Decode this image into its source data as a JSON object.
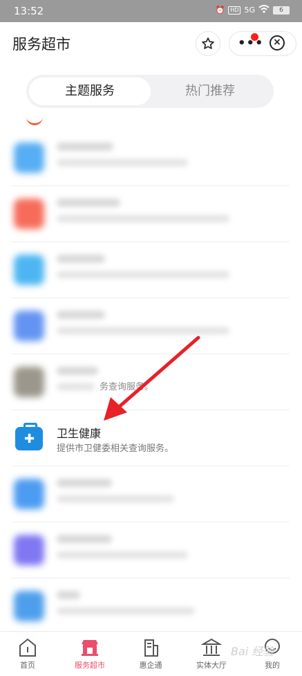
{
  "status_bar": {
    "time": "13:52",
    "network": "5G",
    "hd": "HD",
    "battery": "6"
  },
  "header": {
    "title": "服务超市"
  },
  "segmented": {
    "tabs": [
      "主题服务",
      "热门推荐"
    ],
    "active_index": 0
  },
  "list": {
    "partial_text": "务查询服务。",
    "highlighted": {
      "name": "卫生健康",
      "description": "提供市卫健委相关查询服务。"
    }
  },
  "tabbar": {
    "items": [
      "首页",
      "服务超市",
      "惠企通",
      "实体大厅",
      "我的"
    ],
    "active_index": 1
  },
  "colors": {
    "accent": "#e94f6a",
    "arrow": "#e8202a",
    "health_icon": "#1e8de0"
  },
  "watermark": "Bai 经验"
}
